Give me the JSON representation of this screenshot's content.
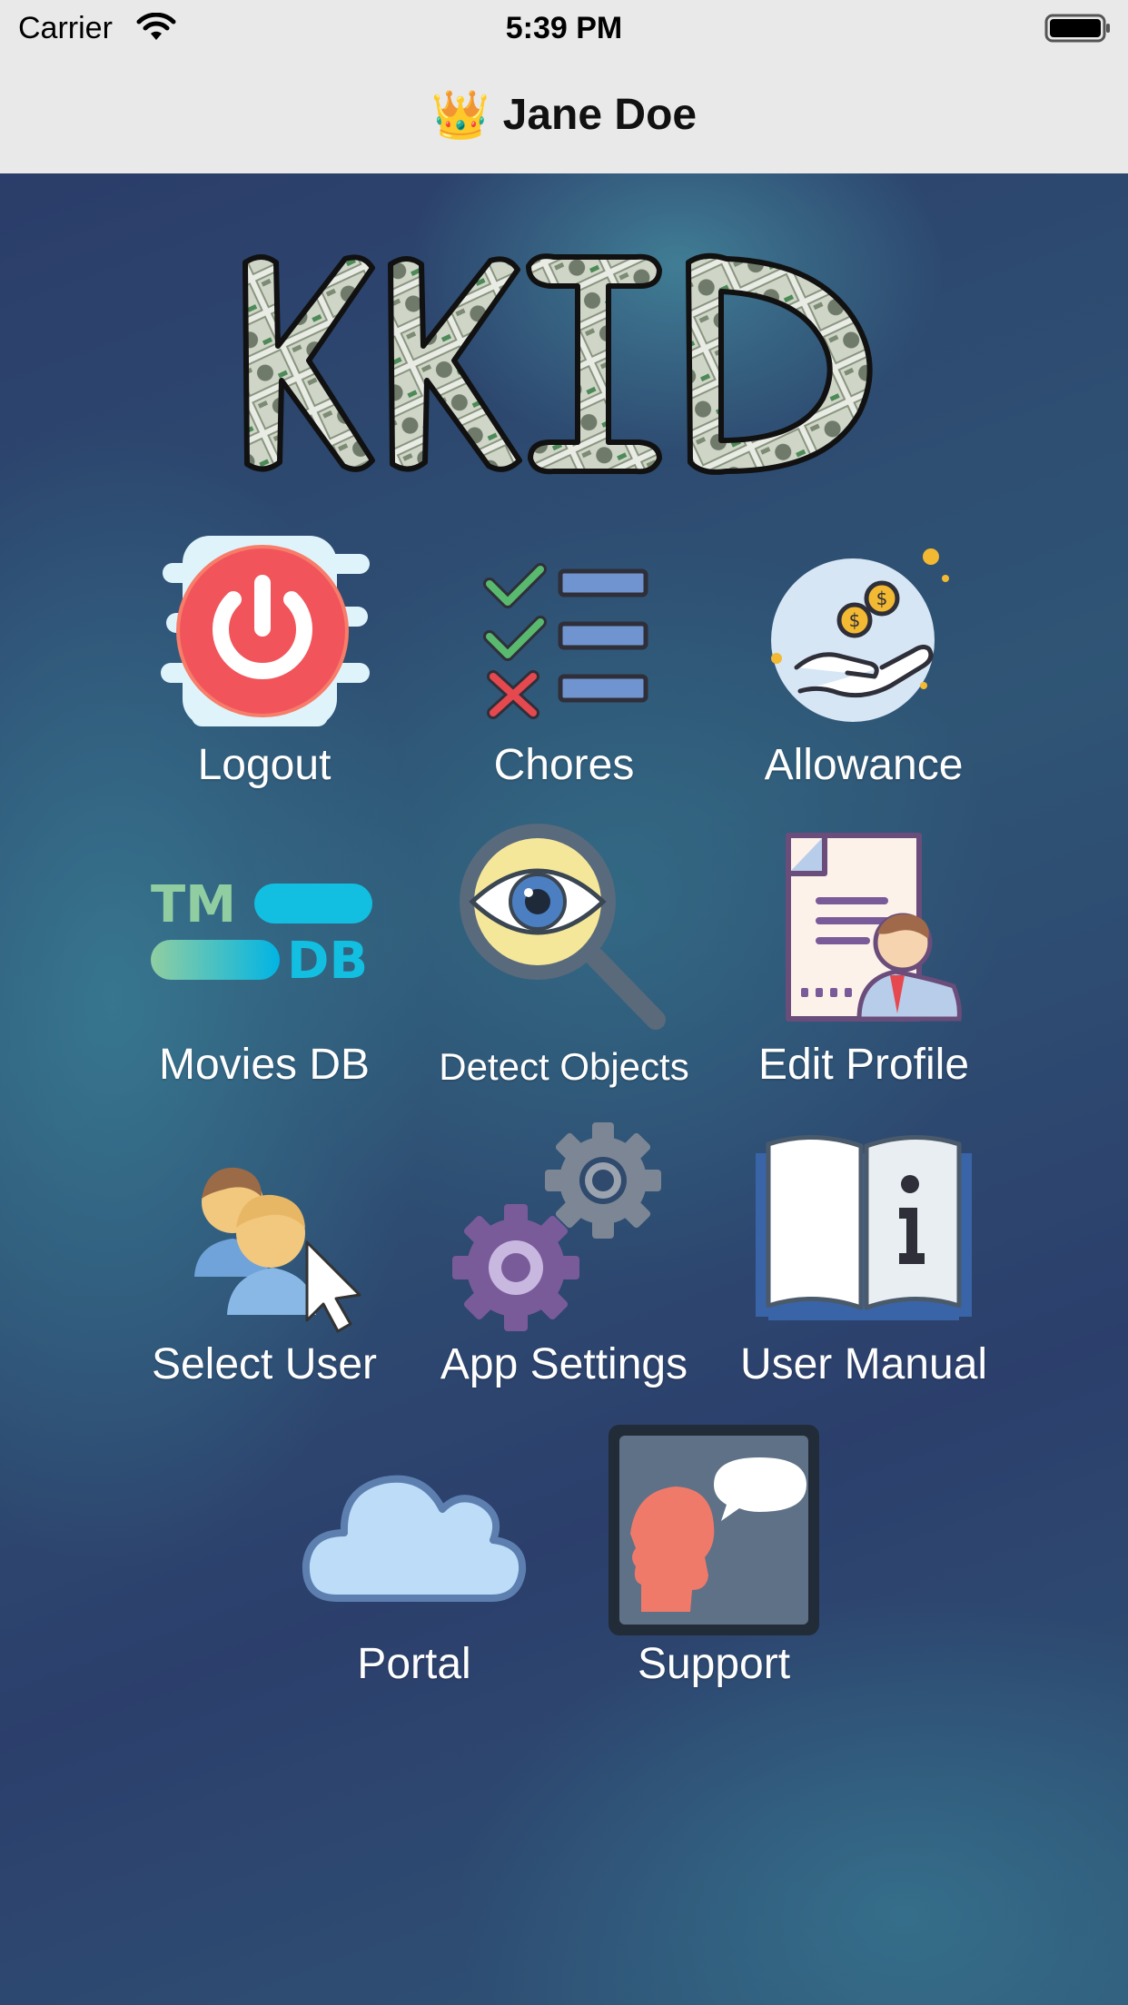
{
  "status_bar": {
    "carrier": "Carrier",
    "time": "5:39 PM"
  },
  "nav": {
    "crown": "👑",
    "title": "Jane Doe"
  },
  "logo": {
    "text": "KKID"
  },
  "menu": [
    {
      "id": "logout",
      "label": "Logout",
      "icon": "power-icon"
    },
    {
      "id": "chores",
      "label": "Chores",
      "icon": "checklist-icon"
    },
    {
      "id": "allowance",
      "label": "Allowance",
      "icon": "coins-hand-icon"
    },
    {
      "id": "movies-db",
      "label": "Movies DB",
      "icon": "tmdb-icon"
    },
    {
      "id": "detect-objects",
      "label": "Detect Objects",
      "icon": "magnifier-eye-icon"
    },
    {
      "id": "edit-profile",
      "label": "Edit Profile",
      "icon": "profile-document-icon"
    },
    {
      "id": "select-user",
      "label": "Select User",
      "icon": "users-cursor-icon"
    },
    {
      "id": "app-settings",
      "label": "App Settings",
      "icon": "gears-icon"
    },
    {
      "id": "user-manual",
      "label": "User Manual",
      "icon": "info-book-icon"
    },
    {
      "id": "portal",
      "label": "Portal",
      "icon": "cloud-icon"
    },
    {
      "id": "support",
      "label": "Support",
      "icon": "support-chat-icon"
    }
  ],
  "tmdb_icon_text": {
    "top": "TM",
    "bottom": "DB"
  }
}
